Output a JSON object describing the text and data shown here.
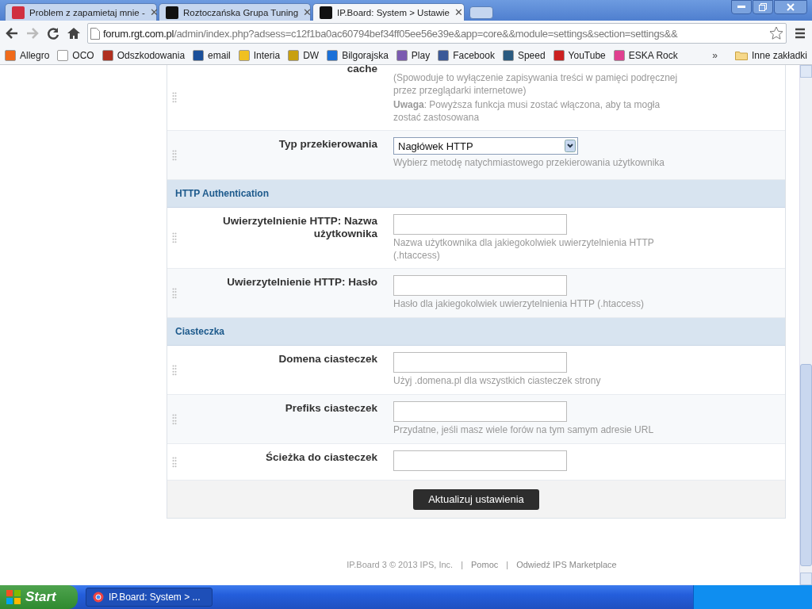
{
  "browser": {
    "tabs": [
      {
        "title": "Problem z zapamietaj mnie -",
        "selected": false,
        "color": "#d03040",
        "close": "✕"
      },
      {
        "title": "Roztoczańska Grupa Tuning",
        "selected": false,
        "color": "#111111",
        "close": "✕"
      },
      {
        "title": "IP.Board: System > Ustawie",
        "selected": true,
        "color": "#111111",
        "close": "✕"
      }
    ],
    "address": {
      "host": "forum.rgt.com.pl",
      "path": "/admin/index.php?adsess=c12f1ba0ac60794bef34ff05ee56e39e&app=core&&module=settings&section=settings&&"
    },
    "bookmarks": [
      {
        "label": "Allegro",
        "color": "#f06a1a"
      },
      {
        "label": "OCO",
        "color": "#ffffff"
      },
      {
        "label": "Odszkodowania",
        "color": "#b03020"
      },
      {
        "label": "email",
        "color": "#1a4f9a"
      },
      {
        "label": "Interia",
        "color": "#f0c020"
      },
      {
        "label": "DW",
        "color": "#c8a010"
      },
      {
        "label": "Bilgorajska",
        "color": "#1a70d8"
      },
      {
        "label": "Play",
        "color": "#7a5ab0"
      },
      {
        "label": "Facebook",
        "color": "#3b5998"
      },
      {
        "label": "Speed",
        "color": "#2a5a80"
      },
      {
        "label": "YouTube",
        "color": "#cc2020"
      },
      {
        "label": "ESKA Rock",
        "color": "#e04090"
      }
    ],
    "overflow": "»",
    "other_bookmarks": "Inne zakładki"
  },
  "settings": {
    "blocks": [
      {
        "kind": "text",
        "label": "cache",
        "lines": [
          "(Spowoduje to wyłączenie zapisywania treści w pamięci podręcznej przez przeglądarki internetowe)",
          "**Uwaga**: Powyższa funkcja musi zostać włączona, aby ta mogła zostać zastosowana"
        ]
      },
      {
        "kind": "select",
        "label": "Typ przekierowania",
        "value": "Nagłówek HTTP",
        "lines": [
          "Wybierz metodę natychmiastowego przekierowania użytkownika"
        ]
      },
      {
        "kind": "section",
        "label": "HTTP Authentication"
      },
      {
        "kind": "input",
        "label": "Uwierzytelnienie HTTP: Nazwa użytkownika",
        "lines": [
          "Nazwa użytkownika dla jakiegokolwiek uwierzytelnienia HTTP (.htaccess)"
        ]
      },
      {
        "kind": "input",
        "label": "Uwierzytelnienie HTTP: Hasło",
        "lines": [
          "Hasło dla jakiegokolwiek uwierzytelnienia HTTP (.htaccess)"
        ]
      },
      {
        "kind": "section",
        "label": "Ciasteczka"
      },
      {
        "kind": "input",
        "label": "Domena ciasteczek",
        "lines": [
          "Użyj .domena.pl dla wszystkich ciasteczek strony"
        ]
      },
      {
        "kind": "input",
        "label": "Prefiks ciasteczek",
        "lines": [
          "Przydatne, jeśli masz wiele forów na tym samym adresie URL"
        ]
      },
      {
        "kind": "input",
        "label": "Ścieżka do ciasteczek"
      }
    ],
    "submit": "Aktualizuj ustawienia"
  },
  "footer": {
    "copyright": "IP.Board 3 © 2013 IPS, Inc.",
    "links": [
      "Pomoc",
      "Odwiedź IPS Marketplace"
    ],
    "separator": "|"
  },
  "taskbar": {
    "start": "Start",
    "task": "IP.Board: System > ..."
  }
}
